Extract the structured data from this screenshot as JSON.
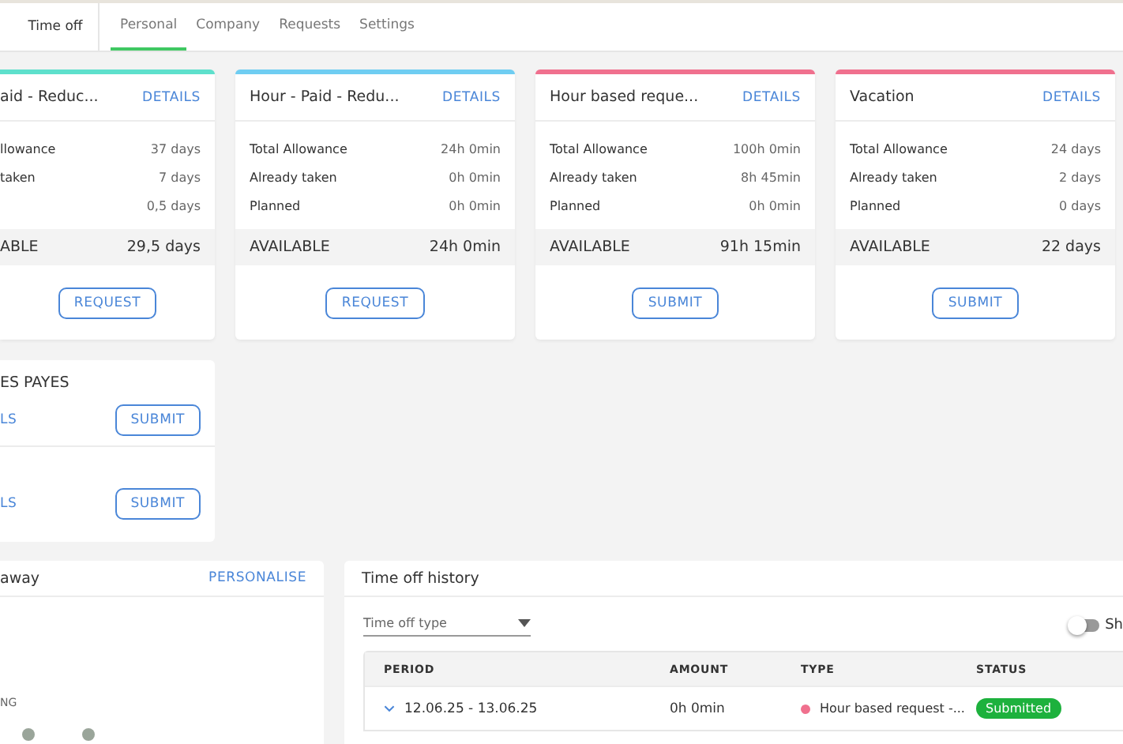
{
  "header": {
    "section": "Time off",
    "tabs": [
      {
        "label": "Personal",
        "selected": true
      },
      {
        "label": "Company",
        "selected": false
      },
      {
        "label": "Requests",
        "selected": false
      },
      {
        "label": "Settings",
        "selected": false
      }
    ]
  },
  "balance_cards": [
    {
      "color": "#5ee0cc",
      "title": "aid - Reduc...",
      "link": "DETAILS",
      "rows": [
        {
          "label": "llowance",
          "value": "37 days"
        },
        {
          "label": "taken",
          "value": "7 days"
        },
        {
          "value": "0,5 days"
        }
      ],
      "available": {
        "label": "ABLE",
        "value": "29,5 days"
      },
      "button": "REQUEST"
    },
    {
      "color": "#6fcdf2",
      "title": "Hour - Paid - Redu...",
      "link": "DETAILS",
      "rows": [
        {
          "label": "Total Allowance",
          "value": "24h 0min"
        },
        {
          "label": "Already taken",
          "value": "0h 0min"
        },
        {
          "label": "Planned",
          "value": "0h 0min"
        }
      ],
      "available": {
        "label": "AVAILABLE",
        "value": "24h 0min"
      },
      "button": "REQUEST"
    },
    {
      "color": "#f0708e",
      "title": "Hour based reque...",
      "link": "DETAILS",
      "rows": [
        {
          "label": "Total Allowance",
          "value": "100h 0min"
        },
        {
          "label": "Already taken",
          "value": "8h 45min"
        },
        {
          "label": "Planned",
          "value": "0h 0min"
        }
      ],
      "available": {
        "label": "AVAILABLE",
        "value": "91h 15min"
      },
      "button": "SUBMIT"
    },
    {
      "color": "#f0708e",
      "title": "Vacation",
      "link": "DETAILS",
      "rows": [
        {
          "label": "Total Allowance",
          "value": "24 days"
        },
        {
          "label": "Already taken",
          "value": "2 days"
        },
        {
          "label": "Planned",
          "value": "0 days"
        }
      ],
      "available": {
        "label": "AVAILABLE",
        "value": "22 days"
      },
      "button": "SUBMIT"
    }
  ],
  "policy_card": {
    "title": "ES PAYES",
    "items": [
      {
        "link": "LS",
        "button": "SUBMIT"
      },
      {
        "link": "LS",
        "button": "SUBMIT"
      }
    ]
  },
  "away_panel": {
    "title": "away",
    "link": "PERSONALISE",
    "label": "NG"
  },
  "history": {
    "title": "Time off history",
    "filter": {
      "placeholder": "Time off type"
    },
    "toggle": {
      "on": false,
      "label": "Sh"
    },
    "table": {
      "columns": [
        "PERIOD",
        "AMOUNT",
        "TYPE",
        "STATUS"
      ],
      "rows": [
        {
          "expanded": false,
          "period": "12.06.25 - 13.06.25",
          "amount": "0h 0min",
          "type": "Hour based request -...",
          "color": "#f0708e",
          "status": "Submitted"
        }
      ]
    }
  }
}
